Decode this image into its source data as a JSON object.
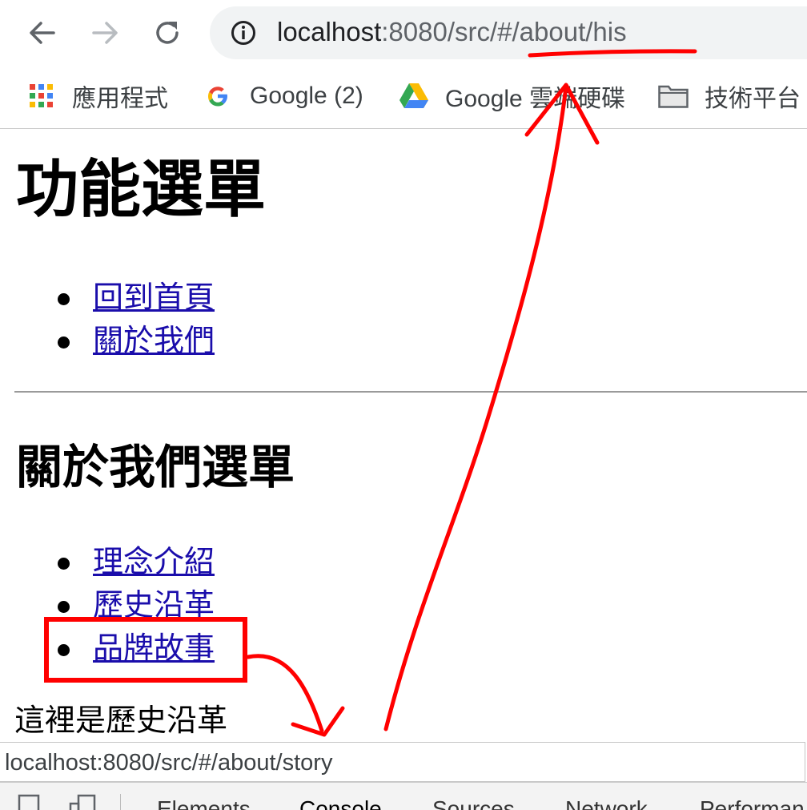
{
  "browser": {
    "url_host": "localhost",
    "url_rest": ":8080/src/#/about/his",
    "bookmarks": [
      {
        "label": "應用程式",
        "icon": "apps-grid-icon"
      },
      {
        "label": "Google (2)",
        "icon": "google-g-icon"
      },
      {
        "label": "Google 雲端硬碟",
        "icon": "google-drive-icon"
      },
      {
        "label": "技術平台",
        "icon": "folder-icon"
      }
    ]
  },
  "page": {
    "title": "功能選單",
    "main_menu": [
      "回到首頁",
      "關於我們"
    ],
    "subtitle": "關於我們選單",
    "about_menu": [
      "理念介紹",
      "歷史沿革",
      "品牌故事"
    ],
    "content_text": "這裡是歷史沿革"
  },
  "status_bar": {
    "link_url": "localhost:8080/src/#/about/story"
  },
  "devtools": {
    "tabs": [
      "Elements",
      "Console",
      "Sources",
      "Network",
      "Performan"
    ]
  },
  "colors": {
    "link": "#1a0dab",
    "annotation": "#ff0000"
  }
}
